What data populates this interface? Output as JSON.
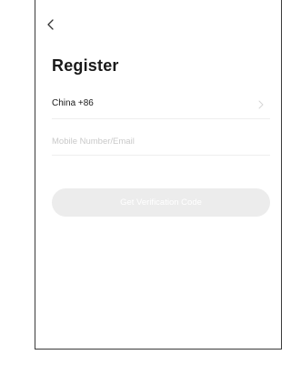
{
  "screen": {
    "title": "Register"
  },
  "nav": {
    "back_icon": "chevron-left-icon"
  },
  "form": {
    "country_label": "China +86",
    "country_chevron_icon": "chevron-right-icon",
    "account_placeholder": "Mobile Number/Email",
    "account_value": "",
    "verify_button_label": "Get Verification Code"
  },
  "colors": {
    "button_disabled_bg": "#ececec",
    "button_text": "#ffffff",
    "placeholder": "#c9c9c9",
    "title_text": "#1a1a1a",
    "frame_border": "#3a3a3a"
  }
}
